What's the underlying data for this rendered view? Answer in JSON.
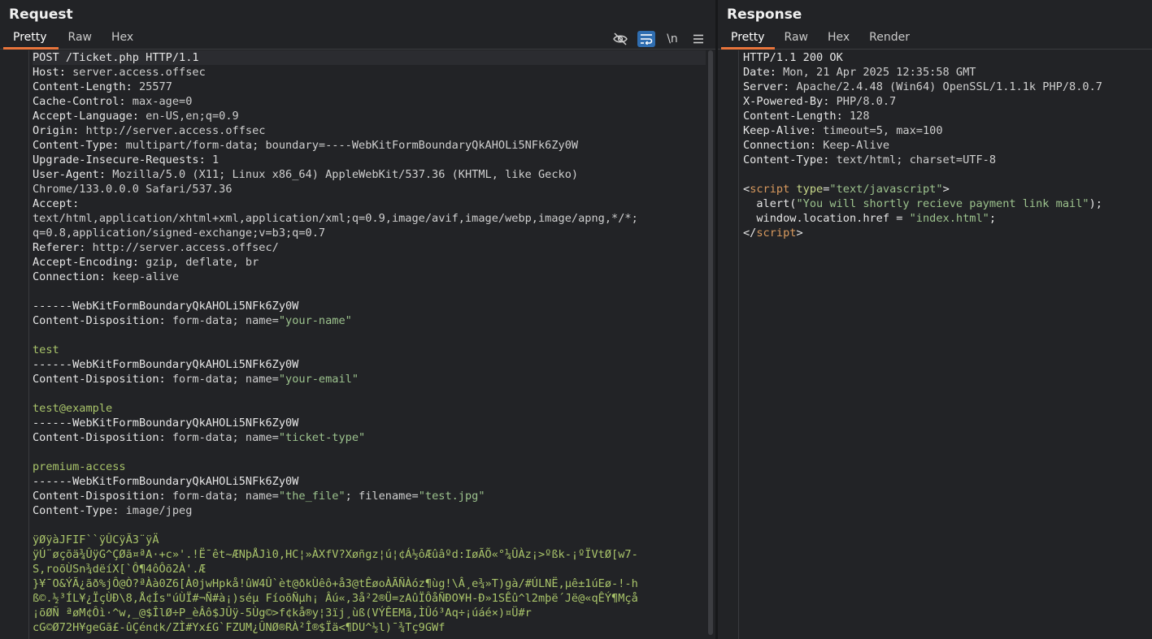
{
  "request": {
    "title": "Request",
    "tabs": [
      "Pretty",
      "Raw",
      "Hex"
    ],
    "active_tab": "Pretty",
    "toolbar_icons": [
      "eye-slash-icon",
      "wrap-lines-icon",
      "newline-icon",
      "menu-icon"
    ],
    "toolbar_newline_label": "\\n",
    "lines": [
      {
        "n": "1",
        "parts": [
          [
            "k",
            "POST /Ticket.php HTTP/1.1"
          ]
        ]
      },
      {
        "n": "2",
        "parts": [
          [
            "k",
            "Host: "
          ],
          [
            "v",
            "server.access.offsec"
          ]
        ]
      },
      {
        "n": "3",
        "parts": [
          [
            "k",
            "Content-Length: "
          ],
          [
            "v",
            "25577"
          ]
        ]
      },
      {
        "n": "4",
        "parts": [
          [
            "k",
            "Cache-Control: "
          ],
          [
            "v",
            "max-age=0"
          ]
        ]
      },
      {
        "n": "5",
        "parts": [
          [
            "k",
            "Accept-Language: "
          ],
          [
            "v",
            "en-US,en;q=0.9"
          ]
        ]
      },
      {
        "n": "6",
        "parts": [
          [
            "k",
            "Origin: "
          ],
          [
            "v",
            "http://server.access.offsec"
          ]
        ]
      },
      {
        "n": "7",
        "parts": [
          [
            "k",
            "Content-Type: "
          ],
          [
            "v",
            "multipart/form-data; boundary=----WebKitFormBoundaryQkAHOLi5NFk6Zy0W"
          ]
        ]
      },
      {
        "n": "8",
        "parts": [
          [
            "k",
            "Upgrade-Insecure-Requests: "
          ],
          [
            "v",
            "1"
          ]
        ]
      },
      {
        "n": "9",
        "parts": [
          [
            "k",
            "User-Agent: "
          ],
          [
            "v",
            "Mozilla/5.0 (X11; Linux x86_64) AppleWebKit/537.36 (KHTML, like Gecko)"
          ]
        ]
      },
      {
        "n": "",
        "parts": [
          [
            "v",
            "Chrome/133.0.0.0 Safari/537.36"
          ]
        ]
      },
      {
        "n": "10",
        "parts": [
          [
            "k",
            "Accept: "
          ]
        ]
      },
      {
        "n": "",
        "parts": [
          [
            "v",
            "text/html,application/xhtml+xml,application/xml;q=0.9,image/avif,image/webp,image/apng,*/*;"
          ]
        ]
      },
      {
        "n": "",
        "parts": [
          [
            "v",
            "q=0.8,application/signed-exchange;v=b3;q=0.7"
          ]
        ]
      },
      {
        "n": "11",
        "parts": [
          [
            "k",
            "Referer: "
          ],
          [
            "v",
            "http://server.access.offsec/"
          ]
        ]
      },
      {
        "n": "12",
        "parts": [
          [
            "k",
            "Accept-Encoding: "
          ],
          [
            "v",
            "gzip, deflate, br"
          ]
        ]
      },
      {
        "n": "13",
        "parts": [
          [
            "k",
            "Connection: "
          ],
          [
            "v",
            "keep-alive"
          ]
        ]
      },
      {
        "n": "14",
        "parts": []
      },
      {
        "n": "15",
        "parts": [
          [
            "k",
            "------WebKitFormBoundaryQkAHOLi5NFk6Zy0W"
          ]
        ]
      },
      {
        "n": "16",
        "parts": [
          [
            "k",
            "Content-Disposition: "
          ],
          [
            "v",
            "form-data; name="
          ],
          [
            "str",
            "\"your-name\""
          ]
        ]
      },
      {
        "n": "17",
        "parts": []
      },
      {
        "n": "18",
        "parts": [
          [
            "body",
            "test"
          ]
        ]
      },
      {
        "n": "19",
        "parts": [
          [
            "k",
            "------WebKitFormBoundaryQkAHOLi5NFk6Zy0W"
          ]
        ]
      },
      {
        "n": "20",
        "parts": [
          [
            "k",
            "Content-Disposition: "
          ],
          [
            "v",
            "form-data; name="
          ],
          [
            "str",
            "\"your-email\""
          ]
        ]
      },
      {
        "n": "21",
        "parts": []
      },
      {
        "n": "22",
        "parts": [
          [
            "body",
            "test@example"
          ]
        ]
      },
      {
        "n": "23",
        "parts": [
          [
            "k",
            "------WebKitFormBoundaryQkAHOLi5NFk6Zy0W"
          ]
        ]
      },
      {
        "n": "24",
        "parts": [
          [
            "k",
            "Content-Disposition: "
          ],
          [
            "v",
            "form-data; name="
          ],
          [
            "str",
            "\"ticket-type\""
          ]
        ]
      },
      {
        "n": "25",
        "parts": []
      },
      {
        "n": "26",
        "parts": [
          [
            "body",
            "premium-access"
          ]
        ]
      },
      {
        "n": "27",
        "parts": [
          [
            "k",
            "------WebKitFormBoundaryQkAHOLi5NFk6Zy0W"
          ]
        ]
      },
      {
        "n": "28",
        "parts": [
          [
            "k",
            "Content-Disposition: "
          ],
          [
            "v",
            "form-data; name="
          ],
          [
            "str",
            "\"the_file\""
          ],
          [
            "v",
            "; filename="
          ],
          [
            "str",
            "\"test.jpg\""
          ]
        ]
      },
      {
        "n": "29",
        "parts": [
          [
            "k",
            "Content-Type: "
          ],
          [
            "v",
            "image/jpeg"
          ]
        ]
      },
      {
        "n": "30",
        "parts": []
      },
      {
        "n": "31",
        "parts": [
          [
            "bin",
            "ÿØÿàJFIF``ÿÛCÿÃ3¨ÿÄ"
          ]
        ]
      },
      {
        "n": "32",
        "parts": [
          [
            "bin",
            "ÿÚ¨øçõä¾ÛÿG^ÇØã¤ªA·+c»'.!Ë¯êt~ÆNþÅJì0,HC¦»ÀXfV?Xøñgz¦ú¦¢Á½ôÆûâºd:IøÃÕ«°¼ÛÀz¡>ºßk-¡ºÏVtØ[w7-"
          ]
        ]
      },
      {
        "n": "",
        "parts": [
          [
            "bin",
            "S,roõÙSn¾dëíX[`Ô¶4ôÔõ2À'.Æ"
          ]
        ]
      },
      {
        "n": "",
        "parts": [
          [
            "bin",
            "}¥¯O&ÝÃ¿ãð%jÔ@Ò?ªÀà0Z6[À0jwHpkå!ûW4Û`èt@ðkÙêô+å3@tÊøoÀÃÑÀóz¶ùg!\\Â¸e¾»T)gà/#ÚLNË,µê±1úEø-!-h"
          ]
        ]
      },
      {
        "n": "",
        "parts": [
          [
            "bin",
            "ß©.½³ÍL¥¿ÏçÙÐ\\8,Å¢Ís\"úÙÏ#¬Ñ#à¡)séµ FíoõÑµh¡ Âú«,3å²2®Ü=zAûÏÔåÑÐO¥H-Ð»1SÊû^l2mþë´Jë@«qÊÝ¶Mçå"
          ]
        ]
      },
      {
        "n": "",
        "parts": [
          [
            "bin",
            "¡õØÑ ªøM¢Ôì·^w,_@$ÎlØ÷P_èÂô$JÛÿ-5Ùg©>f¢kå®y¦3ïj¸ùß(VÝÊEMã,ÌÛó³Aq÷¡úáé×)¤Ü#r"
          ]
        ]
      },
      {
        "n": "",
        "parts": [
          [
            "bin",
            "cG©Ø72H¥geGã£-ûÇén¢k/ZÌ#Yx£G`FZUM¿ÛNØ®RÀ²Î®$Ïä<¶DU^½l)¯¾Tç9GWf"
          ]
        ]
      }
    ]
  },
  "response": {
    "title": "Response",
    "tabs": [
      "Pretty",
      "Raw",
      "Hex",
      "Render"
    ],
    "active_tab": "Pretty",
    "lines": [
      {
        "n": "1",
        "parts": [
          [
            "k",
            "HTTP/1.1 200 OK"
          ]
        ]
      },
      {
        "n": "2",
        "parts": [
          [
            "k",
            "Date: "
          ],
          [
            "v",
            "Mon, 21 Apr 2025 12:35:58 GMT"
          ]
        ]
      },
      {
        "n": "3",
        "parts": [
          [
            "k",
            "Server: "
          ],
          [
            "v",
            "Apache/2.4.48 (Win64) OpenSSL/1.1.1k PHP/8.0.7"
          ]
        ]
      },
      {
        "n": "4",
        "parts": [
          [
            "k",
            "X-Powered-By: "
          ],
          [
            "v",
            "PHP/8.0.7"
          ]
        ]
      },
      {
        "n": "5",
        "parts": [
          [
            "k",
            "Content-Length: "
          ],
          [
            "v",
            "128"
          ]
        ]
      },
      {
        "n": "6",
        "parts": [
          [
            "k",
            "Keep-Alive: "
          ],
          [
            "v",
            "timeout=5, max=100"
          ]
        ]
      },
      {
        "n": "7",
        "parts": [
          [
            "k",
            "Connection: "
          ],
          [
            "v",
            "Keep-Alive"
          ]
        ]
      },
      {
        "n": "8",
        "parts": [
          [
            "k",
            "Content-Type: "
          ],
          [
            "v",
            "text/html; charset=UTF-8"
          ]
        ]
      },
      {
        "n": "9",
        "parts": []
      },
      {
        "n": "10",
        "parts": [
          [
            "k",
            "<"
          ],
          [
            "tag",
            "script"
          ],
          [
            "k",
            " "
          ],
          [
            "att",
            "type"
          ],
          [
            "k",
            "="
          ],
          [
            "str",
            "\"text/javascript\""
          ],
          [
            "k",
            ">"
          ]
        ]
      },
      {
        "n": "",
        "parts": [
          [
            "k",
            "  alert("
          ],
          [
            "str",
            "\"You will shortly recieve payment link mail\""
          ],
          [
            "k",
            ");"
          ]
        ]
      },
      {
        "n": "",
        "parts": [
          [
            "k",
            "  window.location.href = "
          ],
          [
            "str",
            "\"index.html\""
          ],
          [
            "k",
            ";"
          ]
        ]
      },
      {
        "n": "",
        "parts": [
          [
            "k",
            "</"
          ],
          [
            "tag",
            "script"
          ],
          [
            "k",
            ">"
          ]
        ]
      }
    ]
  }
}
